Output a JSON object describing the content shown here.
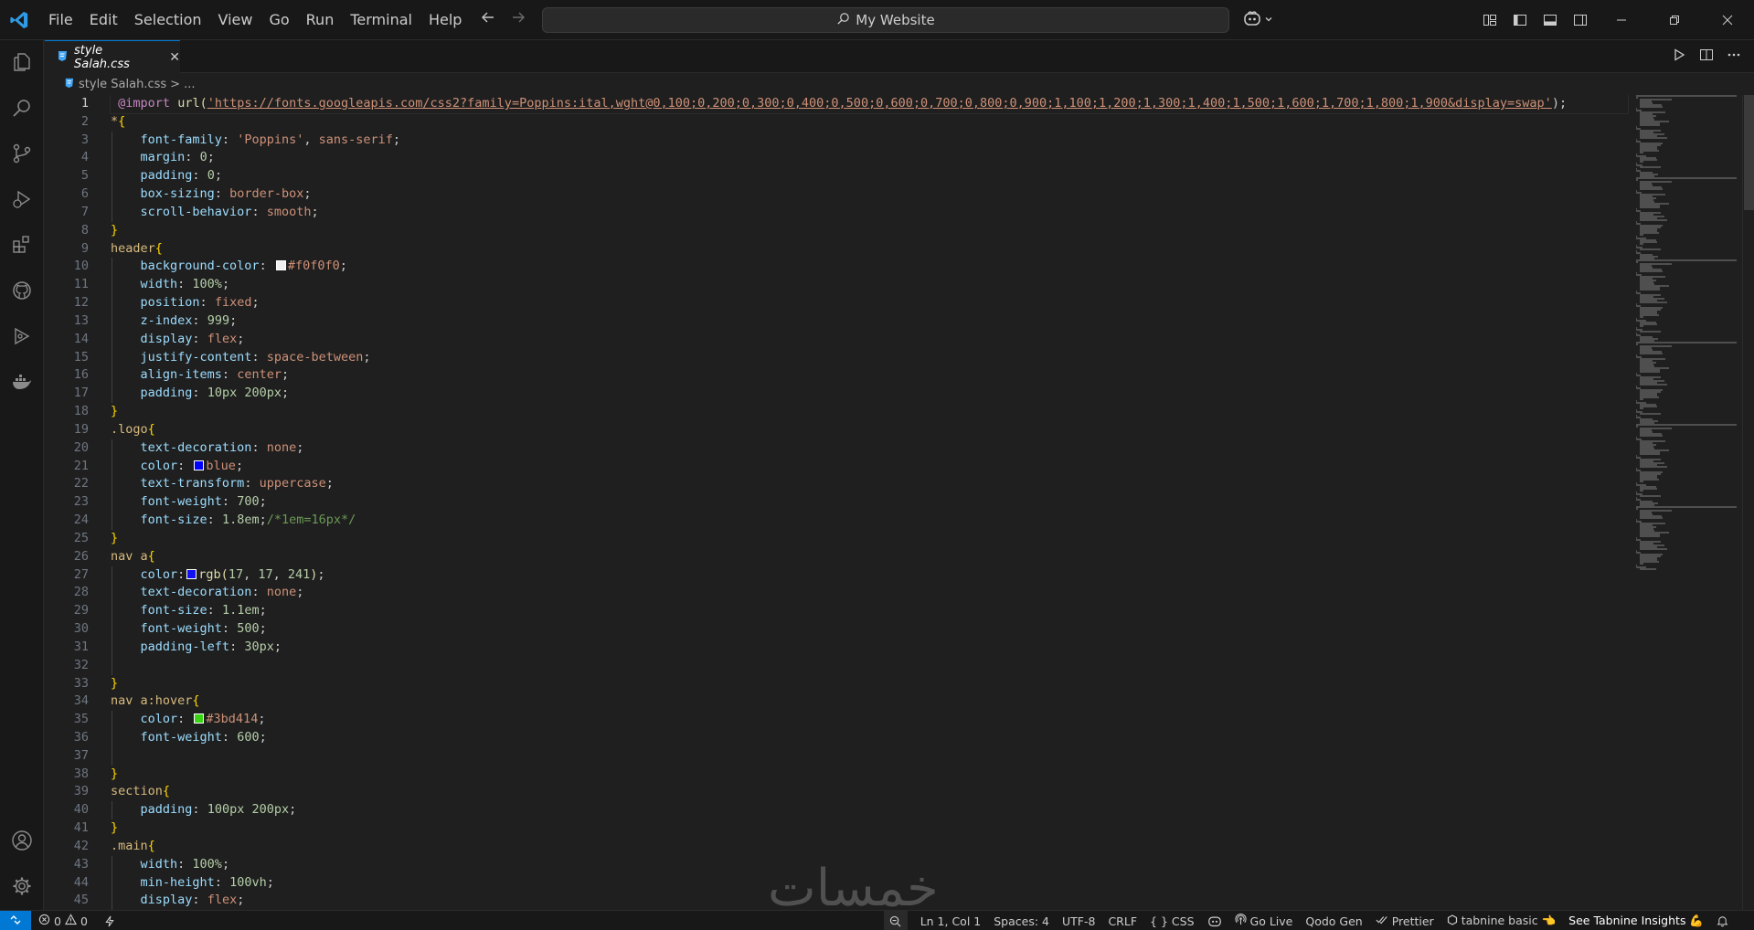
{
  "menubar": [
    "File",
    "Edit",
    "Selection",
    "View",
    "Go",
    "Run",
    "Terminal",
    "Help"
  ],
  "command_center": {
    "label": "My Website"
  },
  "tab": {
    "label": "style Salah.css",
    "close": "✕"
  },
  "breadcrumb": {
    "file": "style Salah.css",
    "separator": ">",
    "more": "..."
  },
  "editor": {
    "active_line": 1,
    "lines": [
      {
        "n": "1",
        "indent": 0,
        "parts": [
          [
            " ",
            "pun"
          ],
          [
            "@import",
            "at"
          ],
          [
            " ",
            "pun"
          ],
          [
            "url(",
            "fn"
          ],
          [
            "'https://fonts.googleapis.com/css2?family=Poppins:ital,wght@0,100;0,200;0,300;0,400;0,500;0,600;0,700;0,800;0,900;1,100;1,200;1,300;1,400;1,500;1,600;1,700;1,800;1,900&display=swap'",
            "str"
          ],
          [
            ");",
            "pun"
          ]
        ]
      },
      {
        "n": "2",
        "indent": 0,
        "parts": [
          [
            "*",
            "sel"
          ],
          [
            "{",
            "brace"
          ]
        ]
      },
      {
        "n": "3",
        "indent": 1,
        "parts": [
          [
            "font-family",
            "prop"
          ],
          [
            ": ",
            "pun"
          ],
          [
            "'Poppins'",
            "val"
          ],
          [
            ", ",
            "pun"
          ],
          [
            "sans-serif",
            "val"
          ],
          [
            ";",
            "pun"
          ]
        ]
      },
      {
        "n": "4",
        "indent": 1,
        "parts": [
          [
            "margin",
            "prop"
          ],
          [
            ": ",
            "pun"
          ],
          [
            "0",
            "num"
          ],
          [
            ";",
            "pun"
          ]
        ]
      },
      {
        "n": "5",
        "indent": 1,
        "parts": [
          [
            "padding",
            "prop"
          ],
          [
            ": ",
            "pun"
          ],
          [
            "0",
            "num"
          ],
          [
            ";",
            "pun"
          ]
        ]
      },
      {
        "n": "6",
        "indent": 1,
        "parts": [
          [
            "box-sizing",
            "prop"
          ],
          [
            ": ",
            "pun"
          ],
          [
            "border-box",
            "val"
          ],
          [
            ";",
            "pun"
          ]
        ]
      },
      {
        "n": "7",
        "indent": 1,
        "parts": [
          [
            "scroll-behavior",
            "prop"
          ],
          [
            ": ",
            "pun"
          ],
          [
            "smooth",
            "val"
          ],
          [
            ";",
            "pun"
          ]
        ]
      },
      {
        "n": "8",
        "indent": 0,
        "parts": [
          [
            "}",
            "brace"
          ]
        ]
      },
      {
        "n": "9",
        "indent": 0,
        "parts": [
          [
            "header",
            "sel"
          ],
          [
            "{",
            "brace"
          ]
        ]
      },
      {
        "n": "10",
        "indent": 1,
        "parts": [
          [
            "background-color",
            "prop"
          ],
          [
            ": ",
            "pun"
          ],
          [
            "#f0f0f0",
            "swatch"
          ],
          [
            "#f0f0f0",
            "val"
          ],
          [
            ";",
            "pun"
          ]
        ]
      },
      {
        "n": "11",
        "indent": 1,
        "parts": [
          [
            "width",
            "prop"
          ],
          [
            ": ",
            "pun"
          ],
          [
            "100%",
            "num"
          ],
          [
            ";",
            "pun"
          ]
        ]
      },
      {
        "n": "12",
        "indent": 1,
        "parts": [
          [
            "position",
            "prop"
          ],
          [
            ": ",
            "pun"
          ],
          [
            "fixed",
            "val"
          ],
          [
            ";",
            "pun"
          ]
        ]
      },
      {
        "n": "13",
        "indent": 1,
        "parts": [
          [
            "z-index",
            "prop"
          ],
          [
            ": ",
            "pun"
          ],
          [
            "999",
            "num"
          ],
          [
            ";",
            "pun"
          ]
        ]
      },
      {
        "n": "14",
        "indent": 1,
        "parts": [
          [
            "display",
            "prop"
          ],
          [
            ": ",
            "pun"
          ],
          [
            "flex",
            "val"
          ],
          [
            ";",
            "pun"
          ]
        ]
      },
      {
        "n": "15",
        "indent": 1,
        "parts": [
          [
            "justify-content",
            "prop"
          ],
          [
            ": ",
            "pun"
          ],
          [
            "space-between",
            "val"
          ],
          [
            ";",
            "pun"
          ]
        ]
      },
      {
        "n": "16",
        "indent": 1,
        "parts": [
          [
            "align-items",
            "prop"
          ],
          [
            ": ",
            "pun"
          ],
          [
            "center",
            "val"
          ],
          [
            ";",
            "pun"
          ]
        ]
      },
      {
        "n": "17",
        "indent": 1,
        "parts": [
          [
            "padding",
            "prop"
          ],
          [
            ": ",
            "pun"
          ],
          [
            "10px 200px",
            "num"
          ],
          [
            ";",
            "pun"
          ]
        ]
      },
      {
        "n": "18",
        "indent": 0,
        "parts": [
          [
            "}",
            "brace"
          ]
        ]
      },
      {
        "n": "19",
        "indent": 0,
        "parts": [
          [
            ".logo",
            "sel"
          ],
          [
            "{",
            "brace"
          ]
        ]
      },
      {
        "n": "20",
        "indent": 1,
        "parts": [
          [
            "text-decoration",
            "prop"
          ],
          [
            ": ",
            "pun"
          ],
          [
            "none",
            "val"
          ],
          [
            ";",
            "pun"
          ]
        ]
      },
      {
        "n": "21",
        "indent": 1,
        "parts": [
          [
            "color",
            "prop"
          ],
          [
            ": ",
            "pun"
          ],
          [
            "#0000ff",
            "swatch"
          ],
          [
            "blue",
            "val"
          ],
          [
            ";",
            "pun"
          ]
        ]
      },
      {
        "n": "22",
        "indent": 1,
        "parts": [
          [
            "text-transform",
            "prop"
          ],
          [
            ": ",
            "pun"
          ],
          [
            "uppercase",
            "val"
          ],
          [
            ";",
            "pun"
          ]
        ]
      },
      {
        "n": "23",
        "indent": 1,
        "parts": [
          [
            "font-weight",
            "prop"
          ],
          [
            ": ",
            "pun"
          ],
          [
            "700",
            "num"
          ],
          [
            ";",
            "pun"
          ]
        ]
      },
      {
        "n": "24",
        "indent": 1,
        "parts": [
          [
            "font-size",
            "prop"
          ],
          [
            ": ",
            "pun"
          ],
          [
            "1.8em",
            "num"
          ],
          [
            ";",
            "pun"
          ],
          [
            "/*1em=16px*/",
            "com"
          ]
        ]
      },
      {
        "n": "25",
        "indent": 0,
        "parts": [
          [
            "}",
            "brace"
          ]
        ]
      },
      {
        "n": "26",
        "indent": 0,
        "parts": [
          [
            "nav a",
            "sel"
          ],
          [
            "{",
            "brace"
          ]
        ]
      },
      {
        "n": "27",
        "indent": 1,
        "parts": [
          [
            "color",
            "prop"
          ],
          [
            ":",
            "pun"
          ],
          [
            "#1111f1",
            "swatch"
          ],
          [
            "rgb(",
            "fn"
          ],
          [
            "17",
            "num"
          ],
          [
            ", ",
            "pun"
          ],
          [
            "17",
            "num"
          ],
          [
            ", ",
            "pun"
          ],
          [
            "241",
            "num"
          ],
          [
            ")",
            "fn"
          ],
          [
            ";",
            "pun"
          ]
        ]
      },
      {
        "n": "28",
        "indent": 1,
        "parts": [
          [
            "text-decoration",
            "prop"
          ],
          [
            ": ",
            "pun"
          ],
          [
            "none",
            "val"
          ],
          [
            ";",
            "pun"
          ]
        ]
      },
      {
        "n": "29",
        "indent": 1,
        "parts": [
          [
            "font-size",
            "prop"
          ],
          [
            ": ",
            "pun"
          ],
          [
            "1.1em",
            "num"
          ],
          [
            ";",
            "pun"
          ]
        ]
      },
      {
        "n": "30",
        "indent": 1,
        "parts": [
          [
            "font-weight",
            "prop"
          ],
          [
            ": ",
            "pun"
          ],
          [
            "500",
            "num"
          ],
          [
            ";",
            "pun"
          ]
        ]
      },
      {
        "n": "31",
        "indent": 1,
        "parts": [
          [
            "padding-left",
            "prop"
          ],
          [
            ": ",
            "pun"
          ],
          [
            "30px",
            "num"
          ],
          [
            ";",
            "pun"
          ]
        ]
      },
      {
        "n": "32",
        "indent": 1,
        "parts": []
      },
      {
        "n": "33",
        "indent": 0,
        "parts": [
          [
            "}",
            "brace"
          ]
        ]
      },
      {
        "n": "34",
        "indent": 0,
        "parts": [
          [
            "nav a:hover",
            "sel"
          ],
          [
            "{",
            "brace"
          ]
        ]
      },
      {
        "n": "35",
        "indent": 1,
        "parts": [
          [
            "color",
            "prop"
          ],
          [
            ": ",
            "pun"
          ],
          [
            "#3bd414",
            "swatch"
          ],
          [
            "#3bd414",
            "val"
          ],
          [
            ";",
            "pun"
          ]
        ]
      },
      {
        "n": "36",
        "indent": 1,
        "parts": [
          [
            "font-weight",
            "prop"
          ],
          [
            ": ",
            "pun"
          ],
          [
            "600",
            "num"
          ],
          [
            ";",
            "pun"
          ]
        ]
      },
      {
        "n": "37",
        "indent": 1,
        "parts": []
      },
      {
        "n": "38",
        "indent": 0,
        "parts": [
          [
            "}",
            "brace"
          ]
        ]
      },
      {
        "n": "39",
        "indent": 0,
        "parts": [
          [
            "section",
            "sel"
          ],
          [
            "{",
            "brace"
          ]
        ]
      },
      {
        "n": "40",
        "indent": 1,
        "parts": [
          [
            "padding",
            "prop"
          ],
          [
            ": ",
            "pun"
          ],
          [
            "100px 200px",
            "num"
          ],
          [
            ";",
            "pun"
          ]
        ]
      },
      {
        "n": "41",
        "indent": 0,
        "parts": [
          [
            "}",
            "brace"
          ]
        ]
      },
      {
        "n": "42",
        "indent": 0,
        "parts": [
          [
            ".main",
            "sel"
          ],
          [
            "{",
            "brace"
          ]
        ]
      },
      {
        "n": "43",
        "indent": 1,
        "parts": [
          [
            "width",
            "prop"
          ],
          [
            ": ",
            "pun"
          ],
          [
            "100%",
            "num"
          ],
          [
            ";",
            "pun"
          ]
        ]
      },
      {
        "n": "44",
        "indent": 1,
        "parts": [
          [
            "min-height",
            "prop"
          ],
          [
            ": ",
            "pun"
          ],
          [
            "100vh",
            "num"
          ],
          [
            ";",
            "pun"
          ]
        ]
      },
      {
        "n": "45",
        "indent": 1,
        "parts": [
          [
            "display",
            "prop"
          ],
          [
            ": ",
            "pun"
          ],
          [
            "flex",
            "val"
          ],
          [
            ";",
            "pun"
          ]
        ]
      }
    ]
  },
  "watermark": "خمسات",
  "statusbar": {
    "errors": "0",
    "warnings": "0",
    "position": "Ln 1, Col 1",
    "spaces": "Spaces: 4",
    "encoding": "UTF-8",
    "eol": "CRLF",
    "language": "CSS",
    "golive": "Go Live",
    "qodo": "Qodo Gen",
    "prettier": "Prettier",
    "tabnine": "tabnine basic 👈",
    "insights": "See Tabnine Insights 💪"
  },
  "colors": {
    "accent": "#0078d4",
    "background": "#1f1f1f",
    "chrome": "#181818"
  }
}
